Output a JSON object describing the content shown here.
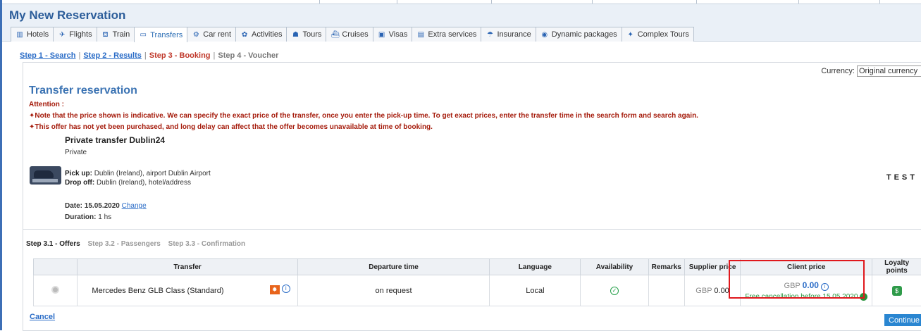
{
  "page_title": "My New Reservation",
  "tabs": [
    {
      "label": "Hotels",
      "icon": "hotel-icon",
      "glyph": "▥",
      "active": false
    },
    {
      "label": "Flights",
      "icon": "plane-icon",
      "glyph": "✈",
      "active": false
    },
    {
      "label": "Train",
      "icon": "train-icon",
      "glyph": "⛾",
      "active": false
    },
    {
      "label": "Transfers",
      "icon": "bus-icon",
      "glyph": "▭",
      "active": true
    },
    {
      "label": "Car rent",
      "icon": "car-icon",
      "glyph": "⚙",
      "active": false
    },
    {
      "label": "Activities",
      "icon": "activities-icon",
      "glyph": "✿",
      "active": false
    },
    {
      "label": "Tours",
      "icon": "tours-icon",
      "glyph": "☗",
      "active": false
    },
    {
      "label": "Cruises",
      "icon": "ship-icon",
      "glyph": "⛴",
      "active": false
    },
    {
      "label": "Visas",
      "icon": "visa-icon",
      "glyph": "▣",
      "active": false
    },
    {
      "label": "Extra services",
      "icon": "extra-services-icon",
      "glyph": "▤",
      "active": false
    },
    {
      "label": "Insurance",
      "icon": "umbrella-icon",
      "glyph": "☂",
      "active": false
    },
    {
      "label": "Dynamic packages",
      "icon": "packages-icon",
      "glyph": "◉",
      "active": false
    },
    {
      "label": "Complex Tours",
      "icon": "complex-tours-icon",
      "glyph": "✦",
      "active": false
    }
  ],
  "steps": {
    "step1": "Step 1 - Search",
    "step2": "Step 2 - Results",
    "step3": "Step 3 - Booking",
    "step4": "Step 4 - Voucher",
    "sep": "|"
  },
  "currency": {
    "label": "Currency:",
    "value": "Original currency"
  },
  "transfer": {
    "title": "Transfer reservation",
    "attention_label": "Attention :",
    "notes": [
      "Note that the price shown is indicative. We can specify the exact price of the transfer, once you enter the pick-up time. To get exact prices, enter the transfer time in the search form and search again.",
      "This offer has not yet been purchased, and long delay can affect that the offer becomes unavailable at time of booking."
    ],
    "name": "Private transfer Dublin24",
    "type": "Private",
    "pickup_label": "Pick up:",
    "pickup_value": "Dublin (Ireland), airport Dublin Airport",
    "dropoff_label": "Drop off:",
    "dropoff_value": "Dublin (Ireland), hotel/address",
    "date_label": "Date:",
    "date_value": "15.05.2020",
    "change_link": "Change",
    "duration_label": "Duration:",
    "duration_value": "1 hs",
    "test_label": "TEST"
  },
  "substeps": {
    "s1": "Step 3.1 - Offers",
    "s2": "Step 3.2 - Passengers",
    "s3": "Step 3.3 - Confirmation"
  },
  "offers_table": {
    "headers": [
      "Transfer",
      "Departure time",
      "Language",
      "Availability",
      "Remarks",
      "Supplier price",
      "Client price",
      "Loyalty points"
    ],
    "rows": [
      {
        "transfer": "Mercedes Benz GLB Class (Standard)",
        "departure": "on request",
        "language": "Local",
        "availability_icon": "check-circle-icon",
        "remarks": "",
        "supplier_currency": "GBP",
        "supplier_amount": "0.00",
        "client_currency": "GBP",
        "client_amount": "0.00",
        "cancellation": "Free cancellation before 15.05.2020"
      }
    ]
  },
  "actions": {
    "cancel": "Cancel",
    "continue": "Continue"
  }
}
